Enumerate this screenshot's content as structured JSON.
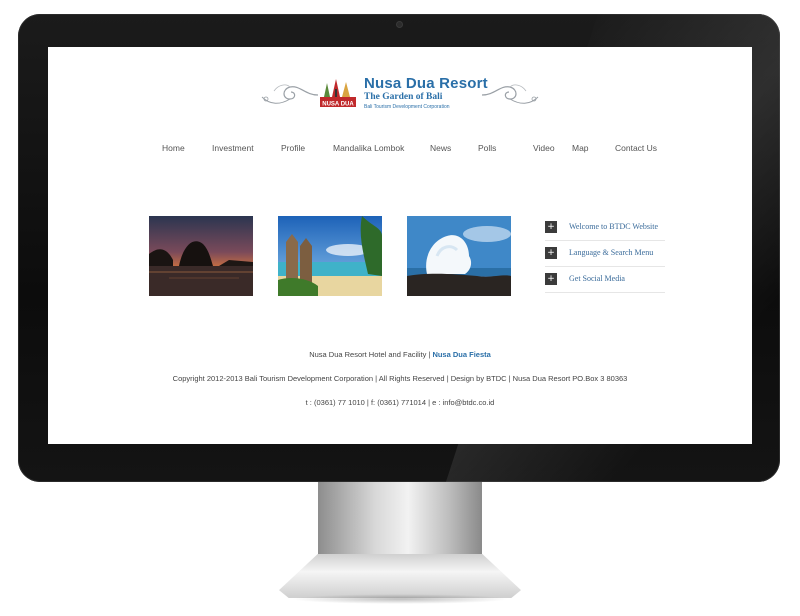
{
  "logo": {
    "title": "Nusa Dua Resort",
    "subtitle": "The Garden of Bali",
    "tagline": "Bali Tourism Development Corporation",
    "emblem_text": "NUSA DUA"
  },
  "nav": {
    "items": [
      "Home",
      "Investment",
      "Profile",
      "Mandalika Lombok",
      "News",
      "Polls",
      "Video",
      "Map",
      "Contact Us"
    ]
  },
  "gallery": [
    {
      "subject": "sunset-rock-islands"
    },
    {
      "subject": "beach-temple-gate"
    },
    {
      "subject": "wave-splash-rocks"
    }
  ],
  "side_menu": {
    "icon": "plus-icon",
    "icon_glyph": "+",
    "items": [
      "Welcome to BTDC Website",
      "Language & Search Menu",
      "Get Social Media"
    ]
  },
  "footer": {
    "line1_text": "Nusa Dua Resort Hotel and Facility | ",
    "line1_link": "Nusa Dua Fiesta",
    "line2": "Copyright 2012-2013 Bali Tourism Development Corporation | All Rights Reserved | Design by BTDC | Nusa Dua Resort PO.Box 3 80363",
    "line3": "t : (0361) 77 1010 | f: (0361) 771014 | e : info@btdc.co.id"
  },
  "colors": {
    "brand_blue": "#2a6fa8",
    "bezel": "#111111",
    "plus_box": "#3b3b3b"
  }
}
